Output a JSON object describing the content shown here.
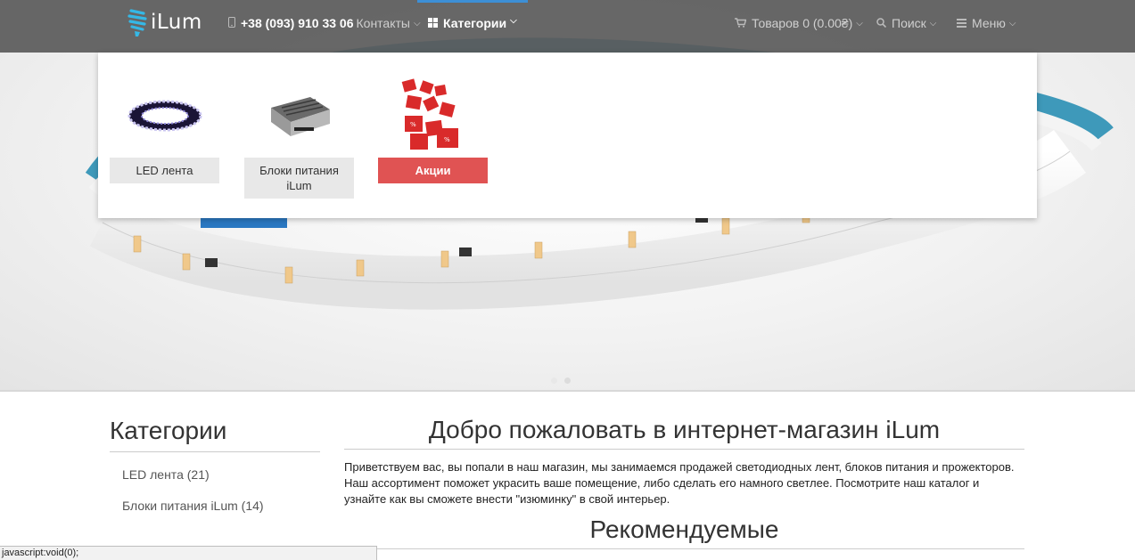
{
  "brand": {
    "name": "iLum"
  },
  "nav": {
    "phone": "+38 (093) 910 33 06",
    "contacts": "Контакты",
    "categories": "Категории",
    "cart": "Товаров 0 (0.00₴)",
    "search": "Поиск",
    "menu": "Меню"
  },
  "dropdown": {
    "items": [
      {
        "label": "LED лента"
      },
      {
        "label": "Блоки питания iLum"
      },
      {
        "label": "Акции"
      }
    ]
  },
  "sidebar": {
    "title": "Категории",
    "links": [
      {
        "label": "LED лента (21)"
      },
      {
        "label": "Блоки питания iLum (14)"
      }
    ]
  },
  "main": {
    "title": "Добро пожаловать в интернет-магазин iLum",
    "intro": "Приветствуем вас, вы попали в наш магазин, мы занимаемся продажей светодиодных лент, блоков питания и прожекторов. Наш ассортимент поможет украсить ваше помещение, либо сделать его намного светлее. Посмотрите наш каталог и узнайте как вы сможете внести \"изюминку\" в свой интерьер.",
    "recommended": "Рекомендуемые"
  },
  "statusbar": {
    "text": "javascript:void(0);"
  },
  "colors": {
    "accent": "#3d8fd6",
    "promo": "#e05353",
    "navbar": "#5a5a5a"
  }
}
